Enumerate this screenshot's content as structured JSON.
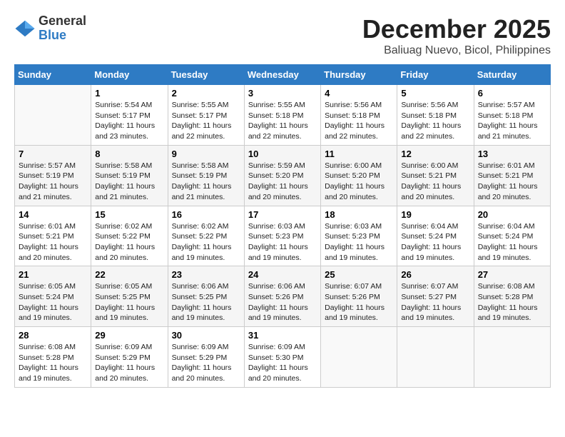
{
  "logo": {
    "general": "General",
    "blue": "Blue"
  },
  "title": "December 2025",
  "location": "Baliuag Nuevo, Bicol, Philippines",
  "days_header": [
    "Sunday",
    "Monday",
    "Tuesday",
    "Wednesday",
    "Thursday",
    "Friday",
    "Saturday"
  ],
  "weeks": [
    [
      {
        "day": "",
        "info": ""
      },
      {
        "day": "1",
        "info": "Sunrise: 5:54 AM\nSunset: 5:17 PM\nDaylight: 11 hours\nand 23 minutes."
      },
      {
        "day": "2",
        "info": "Sunrise: 5:55 AM\nSunset: 5:17 PM\nDaylight: 11 hours\nand 22 minutes."
      },
      {
        "day": "3",
        "info": "Sunrise: 5:55 AM\nSunset: 5:18 PM\nDaylight: 11 hours\nand 22 minutes."
      },
      {
        "day": "4",
        "info": "Sunrise: 5:56 AM\nSunset: 5:18 PM\nDaylight: 11 hours\nand 22 minutes."
      },
      {
        "day": "5",
        "info": "Sunrise: 5:56 AM\nSunset: 5:18 PM\nDaylight: 11 hours\nand 22 minutes."
      },
      {
        "day": "6",
        "info": "Sunrise: 5:57 AM\nSunset: 5:18 PM\nDaylight: 11 hours\nand 21 minutes."
      }
    ],
    [
      {
        "day": "7",
        "info": "Sunrise: 5:57 AM\nSunset: 5:19 PM\nDaylight: 11 hours\nand 21 minutes."
      },
      {
        "day": "8",
        "info": "Sunrise: 5:58 AM\nSunset: 5:19 PM\nDaylight: 11 hours\nand 21 minutes."
      },
      {
        "day": "9",
        "info": "Sunrise: 5:58 AM\nSunset: 5:19 PM\nDaylight: 11 hours\nand 21 minutes."
      },
      {
        "day": "10",
        "info": "Sunrise: 5:59 AM\nSunset: 5:20 PM\nDaylight: 11 hours\nand 20 minutes."
      },
      {
        "day": "11",
        "info": "Sunrise: 6:00 AM\nSunset: 5:20 PM\nDaylight: 11 hours\nand 20 minutes."
      },
      {
        "day": "12",
        "info": "Sunrise: 6:00 AM\nSunset: 5:21 PM\nDaylight: 11 hours\nand 20 minutes."
      },
      {
        "day": "13",
        "info": "Sunrise: 6:01 AM\nSunset: 5:21 PM\nDaylight: 11 hours\nand 20 minutes."
      }
    ],
    [
      {
        "day": "14",
        "info": "Sunrise: 6:01 AM\nSunset: 5:21 PM\nDaylight: 11 hours\nand 20 minutes."
      },
      {
        "day": "15",
        "info": "Sunrise: 6:02 AM\nSunset: 5:22 PM\nDaylight: 11 hours\nand 20 minutes."
      },
      {
        "day": "16",
        "info": "Sunrise: 6:02 AM\nSunset: 5:22 PM\nDaylight: 11 hours\nand 19 minutes."
      },
      {
        "day": "17",
        "info": "Sunrise: 6:03 AM\nSunset: 5:23 PM\nDaylight: 11 hours\nand 19 minutes."
      },
      {
        "day": "18",
        "info": "Sunrise: 6:03 AM\nSunset: 5:23 PM\nDaylight: 11 hours\nand 19 minutes."
      },
      {
        "day": "19",
        "info": "Sunrise: 6:04 AM\nSunset: 5:24 PM\nDaylight: 11 hours\nand 19 minutes."
      },
      {
        "day": "20",
        "info": "Sunrise: 6:04 AM\nSunset: 5:24 PM\nDaylight: 11 hours\nand 19 minutes."
      }
    ],
    [
      {
        "day": "21",
        "info": "Sunrise: 6:05 AM\nSunset: 5:24 PM\nDaylight: 11 hours\nand 19 minutes."
      },
      {
        "day": "22",
        "info": "Sunrise: 6:05 AM\nSunset: 5:25 PM\nDaylight: 11 hours\nand 19 minutes."
      },
      {
        "day": "23",
        "info": "Sunrise: 6:06 AM\nSunset: 5:25 PM\nDaylight: 11 hours\nand 19 minutes."
      },
      {
        "day": "24",
        "info": "Sunrise: 6:06 AM\nSunset: 5:26 PM\nDaylight: 11 hours\nand 19 minutes."
      },
      {
        "day": "25",
        "info": "Sunrise: 6:07 AM\nSunset: 5:26 PM\nDaylight: 11 hours\nand 19 minutes."
      },
      {
        "day": "26",
        "info": "Sunrise: 6:07 AM\nSunset: 5:27 PM\nDaylight: 11 hours\nand 19 minutes."
      },
      {
        "day": "27",
        "info": "Sunrise: 6:08 AM\nSunset: 5:28 PM\nDaylight: 11 hours\nand 19 minutes."
      }
    ],
    [
      {
        "day": "28",
        "info": "Sunrise: 6:08 AM\nSunset: 5:28 PM\nDaylight: 11 hours\nand 19 minutes."
      },
      {
        "day": "29",
        "info": "Sunrise: 6:09 AM\nSunset: 5:29 PM\nDaylight: 11 hours\nand 20 minutes."
      },
      {
        "day": "30",
        "info": "Sunrise: 6:09 AM\nSunset: 5:29 PM\nDaylight: 11 hours\nand 20 minutes."
      },
      {
        "day": "31",
        "info": "Sunrise: 6:09 AM\nSunset: 5:30 PM\nDaylight: 11 hours\nand 20 minutes."
      },
      {
        "day": "",
        "info": ""
      },
      {
        "day": "",
        "info": ""
      },
      {
        "day": "",
        "info": ""
      }
    ]
  ]
}
